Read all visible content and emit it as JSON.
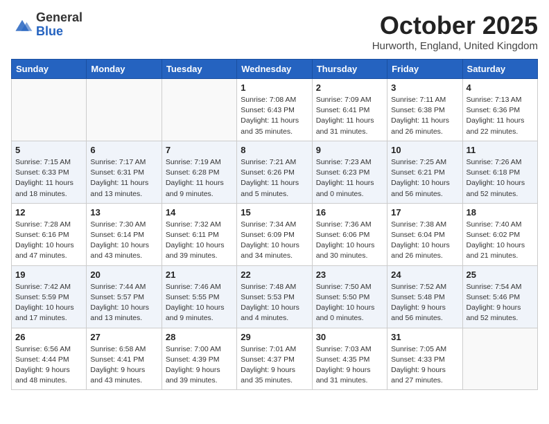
{
  "logo": {
    "general": "General",
    "blue": "Blue"
  },
  "title": {
    "month_year": "October 2025",
    "location": "Hurworth, England, United Kingdom"
  },
  "headers": [
    "Sunday",
    "Monday",
    "Tuesday",
    "Wednesday",
    "Thursday",
    "Friday",
    "Saturday"
  ],
  "weeks": [
    [
      {
        "day": "",
        "info": ""
      },
      {
        "day": "",
        "info": ""
      },
      {
        "day": "",
        "info": ""
      },
      {
        "day": "1",
        "info": "Sunrise: 7:08 AM\nSunset: 6:43 PM\nDaylight: 11 hours\nand 35 minutes."
      },
      {
        "day": "2",
        "info": "Sunrise: 7:09 AM\nSunset: 6:41 PM\nDaylight: 11 hours\nand 31 minutes."
      },
      {
        "day": "3",
        "info": "Sunrise: 7:11 AM\nSunset: 6:38 PM\nDaylight: 11 hours\nand 26 minutes."
      },
      {
        "day": "4",
        "info": "Sunrise: 7:13 AM\nSunset: 6:36 PM\nDaylight: 11 hours\nand 22 minutes."
      }
    ],
    [
      {
        "day": "5",
        "info": "Sunrise: 7:15 AM\nSunset: 6:33 PM\nDaylight: 11 hours\nand 18 minutes."
      },
      {
        "day": "6",
        "info": "Sunrise: 7:17 AM\nSunset: 6:31 PM\nDaylight: 11 hours\nand 13 minutes."
      },
      {
        "day": "7",
        "info": "Sunrise: 7:19 AM\nSunset: 6:28 PM\nDaylight: 11 hours\nand 9 minutes."
      },
      {
        "day": "8",
        "info": "Sunrise: 7:21 AM\nSunset: 6:26 PM\nDaylight: 11 hours\nand 5 minutes."
      },
      {
        "day": "9",
        "info": "Sunrise: 7:23 AM\nSunset: 6:23 PM\nDaylight: 11 hours\nand 0 minutes."
      },
      {
        "day": "10",
        "info": "Sunrise: 7:25 AM\nSunset: 6:21 PM\nDaylight: 10 hours\nand 56 minutes."
      },
      {
        "day": "11",
        "info": "Sunrise: 7:26 AM\nSunset: 6:18 PM\nDaylight: 10 hours\nand 52 minutes."
      }
    ],
    [
      {
        "day": "12",
        "info": "Sunrise: 7:28 AM\nSunset: 6:16 PM\nDaylight: 10 hours\nand 47 minutes."
      },
      {
        "day": "13",
        "info": "Sunrise: 7:30 AM\nSunset: 6:14 PM\nDaylight: 10 hours\nand 43 minutes."
      },
      {
        "day": "14",
        "info": "Sunrise: 7:32 AM\nSunset: 6:11 PM\nDaylight: 10 hours\nand 39 minutes."
      },
      {
        "day": "15",
        "info": "Sunrise: 7:34 AM\nSunset: 6:09 PM\nDaylight: 10 hours\nand 34 minutes."
      },
      {
        "day": "16",
        "info": "Sunrise: 7:36 AM\nSunset: 6:06 PM\nDaylight: 10 hours\nand 30 minutes."
      },
      {
        "day": "17",
        "info": "Sunrise: 7:38 AM\nSunset: 6:04 PM\nDaylight: 10 hours\nand 26 minutes."
      },
      {
        "day": "18",
        "info": "Sunrise: 7:40 AM\nSunset: 6:02 PM\nDaylight: 10 hours\nand 21 minutes."
      }
    ],
    [
      {
        "day": "19",
        "info": "Sunrise: 7:42 AM\nSunset: 5:59 PM\nDaylight: 10 hours\nand 17 minutes."
      },
      {
        "day": "20",
        "info": "Sunrise: 7:44 AM\nSunset: 5:57 PM\nDaylight: 10 hours\nand 13 minutes."
      },
      {
        "day": "21",
        "info": "Sunrise: 7:46 AM\nSunset: 5:55 PM\nDaylight: 10 hours\nand 9 minutes."
      },
      {
        "day": "22",
        "info": "Sunrise: 7:48 AM\nSunset: 5:53 PM\nDaylight: 10 hours\nand 4 minutes."
      },
      {
        "day": "23",
        "info": "Sunrise: 7:50 AM\nSunset: 5:50 PM\nDaylight: 10 hours\nand 0 minutes."
      },
      {
        "day": "24",
        "info": "Sunrise: 7:52 AM\nSunset: 5:48 PM\nDaylight: 9 hours\nand 56 minutes."
      },
      {
        "day": "25",
        "info": "Sunrise: 7:54 AM\nSunset: 5:46 PM\nDaylight: 9 hours\nand 52 minutes."
      }
    ],
    [
      {
        "day": "26",
        "info": "Sunrise: 6:56 AM\nSunset: 4:44 PM\nDaylight: 9 hours\nand 48 minutes."
      },
      {
        "day": "27",
        "info": "Sunrise: 6:58 AM\nSunset: 4:41 PM\nDaylight: 9 hours\nand 43 minutes."
      },
      {
        "day": "28",
        "info": "Sunrise: 7:00 AM\nSunset: 4:39 PM\nDaylight: 9 hours\nand 39 minutes."
      },
      {
        "day": "29",
        "info": "Sunrise: 7:01 AM\nSunset: 4:37 PM\nDaylight: 9 hours\nand 35 minutes."
      },
      {
        "day": "30",
        "info": "Sunrise: 7:03 AM\nSunset: 4:35 PM\nDaylight: 9 hours\nand 31 minutes."
      },
      {
        "day": "31",
        "info": "Sunrise: 7:05 AM\nSunset: 4:33 PM\nDaylight: 9 hours\nand 27 minutes."
      },
      {
        "day": "",
        "info": ""
      }
    ]
  ]
}
